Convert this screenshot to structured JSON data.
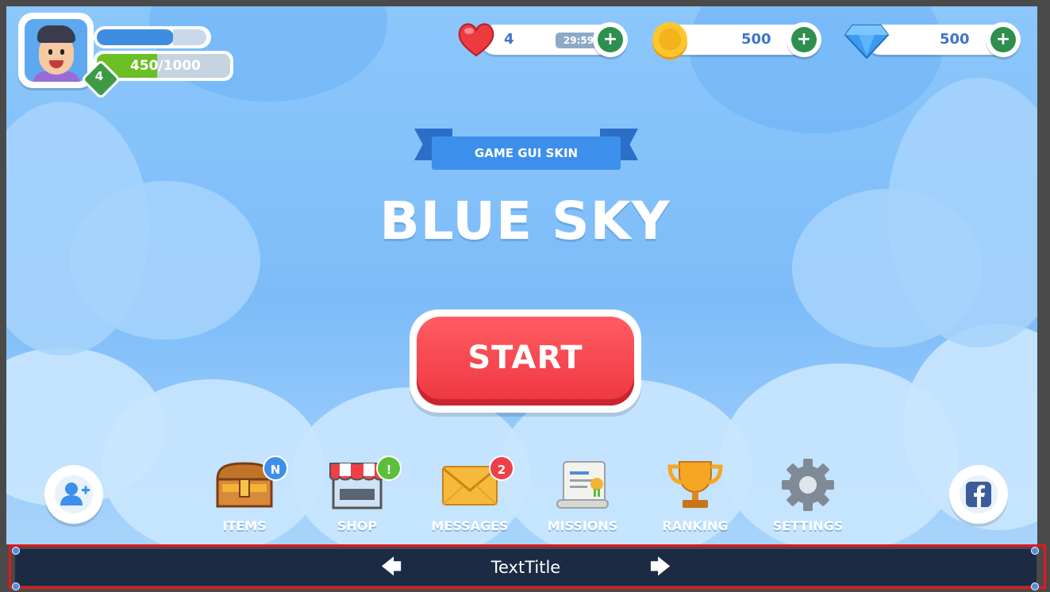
{
  "player": {
    "level": "4",
    "xp": "450/1000",
    "xp_fraction": 0.45,
    "energy_fraction": 0.7
  },
  "currencies": {
    "lives": {
      "value": "4",
      "timer": "29:59",
      "icon": "heart-icon"
    },
    "coins": {
      "value": "500",
      "icon": "coin-icon"
    },
    "gems": {
      "value": "500",
      "icon": "diamond-icon"
    }
  },
  "title": {
    "ribbon": "GAME GUI SKIN",
    "main": "BLUE SKY"
  },
  "start_button": {
    "label": "START"
  },
  "menu": [
    {
      "label": "ITEMS",
      "icon": "treasure-chest-icon",
      "badge": "N"
    },
    {
      "label": "SHOP",
      "icon": "shop-icon",
      "badge": "!"
    },
    {
      "label": "MESSAGES",
      "icon": "envelope-icon",
      "badge": "2"
    },
    {
      "label": "MISSIONS",
      "icon": "scroll-icon"
    },
    {
      "label": "RANKING",
      "icon": "trophy-icon"
    },
    {
      "label": "SETTINGS",
      "icon": "gear-icon"
    }
  ],
  "side_buttons": {
    "add_friend": {
      "icon": "add-friend-icon"
    },
    "facebook": {
      "icon": "facebook-icon"
    }
  },
  "bottom_bar": {
    "title": "TextTitle",
    "left_arrow": "🡄",
    "right_arrow": "🡆"
  },
  "colors": {
    "sky": "#7dbcf9",
    "start_red": "#ee3640",
    "plus_green": "#2f8f4e",
    "bottom_bar": "#1c2a43",
    "selection_border": "#e8151d"
  }
}
